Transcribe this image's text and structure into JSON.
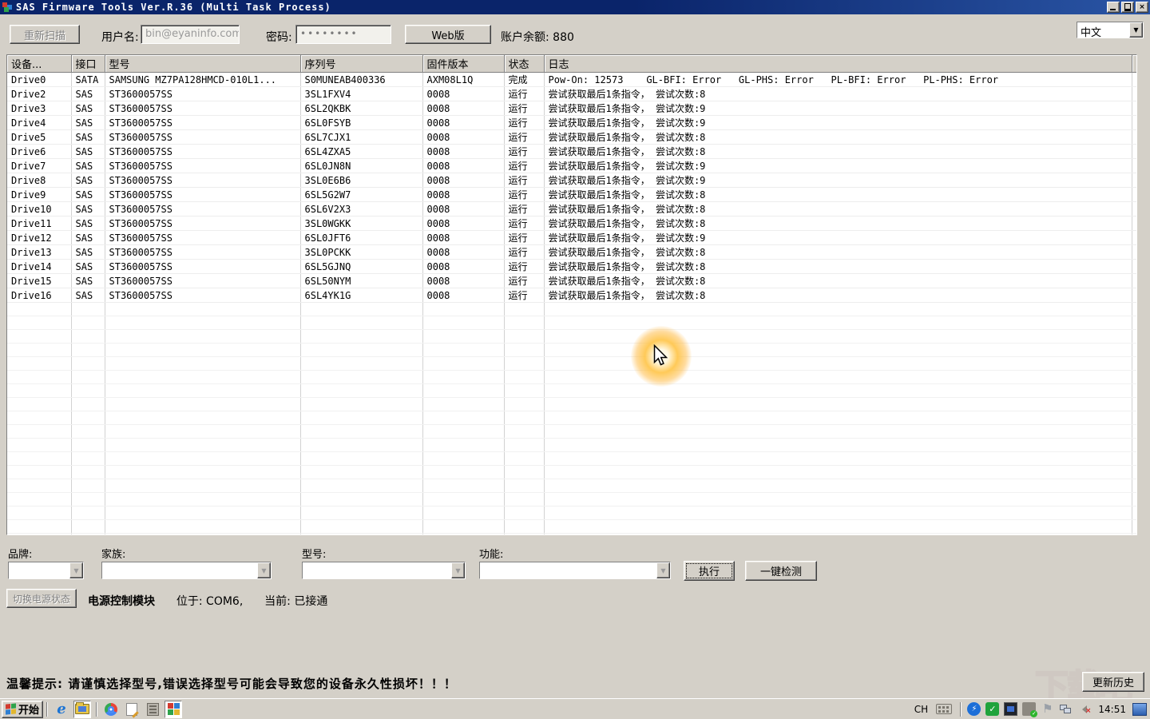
{
  "window": {
    "title": "SAS Firmware Tools Ver.R.36 (Multi Task Process)"
  },
  "toolbar": {
    "rescan": "重新扫描",
    "username_label": "用户名:",
    "username": "bin@eyaninfo.com",
    "password_label": "密码:",
    "password_masked": "••••••••",
    "web_version": "Web版",
    "balance": "账户余额: 880",
    "language": "中文",
    "dropdown_arrow": "▼"
  },
  "table": {
    "headers": [
      "设备...",
      "接口",
      "型号",
      "序列号",
      "固件版本",
      "状态",
      "日志"
    ],
    "rows": [
      [
        "Drive0",
        "SATA",
        "SAMSUNG MZ7PA128HMCD-010L1...",
        "S0MUNEAB400336",
        "AXM08L1Q",
        "完成",
        "Pow-On: 12573    GL-BFI: Error   GL-PHS: Error   PL-BFI: Error   PL-PHS: Error"
      ],
      [
        "Drive2",
        "SAS",
        "ST3600057SS",
        "3SL1FXV4",
        "0008",
        "运行",
        "尝试获取最后1条指令， 尝试次数:8"
      ],
      [
        "Drive3",
        "SAS",
        "ST3600057SS",
        "6SL2QKBK",
        "0008",
        "运行",
        "尝试获取最后1条指令， 尝试次数:9"
      ],
      [
        "Drive4",
        "SAS",
        "ST3600057SS",
        "6SL0FSYB",
        "0008",
        "运行",
        "尝试获取最后1条指令， 尝试次数:9"
      ],
      [
        "Drive5",
        "SAS",
        "ST3600057SS",
        "6SL7CJX1",
        "0008",
        "运行",
        "尝试获取最后1条指令， 尝试次数:8"
      ],
      [
        "Drive6",
        "SAS",
        "ST3600057SS",
        "6SL4ZXA5",
        "0008",
        "运行",
        "尝试获取最后1条指令， 尝试次数:8"
      ],
      [
        "Drive7",
        "SAS",
        "ST3600057SS",
        "6SL0JN8N",
        "0008",
        "运行",
        "尝试获取最后1条指令， 尝试次数:9"
      ],
      [
        "Drive8",
        "SAS",
        "ST3600057SS",
        "3SL0E6B6",
        "0008",
        "运行",
        "尝试获取最后1条指令， 尝试次数:9"
      ],
      [
        "Drive9",
        "SAS",
        "ST3600057SS",
        "6SL5G2W7",
        "0008",
        "运行",
        "尝试获取最后1条指令， 尝试次数:8"
      ],
      [
        "Drive10",
        "SAS",
        "ST3600057SS",
        "6SL6V2X3",
        "0008",
        "运行",
        "尝试获取最后1条指令， 尝试次数:8"
      ],
      [
        "Drive11",
        "SAS",
        "ST3600057SS",
        "3SL0WGKK",
        "0008",
        "运行",
        "尝试获取最后1条指令， 尝试次数:8"
      ],
      [
        "Drive12",
        "SAS",
        "ST3600057SS",
        "6SL0JFT6",
        "0008",
        "运行",
        "尝试获取最后1条指令， 尝试次数:9"
      ],
      [
        "Drive13",
        "SAS",
        "ST3600057SS",
        "3SL0PCKK",
        "0008",
        "运行",
        "尝试获取最后1条指令， 尝试次数:8"
      ],
      [
        "Drive14",
        "SAS",
        "ST3600057SS",
        "6SL5GJNQ",
        "0008",
        "运行",
        "尝试获取最后1条指令， 尝试次数:8"
      ],
      [
        "Drive15",
        "SAS",
        "ST3600057SS",
        "6SL50NYM",
        "0008",
        "运行",
        "尝试获取最后1条指令， 尝试次数:8"
      ],
      [
        "Drive16",
        "SAS",
        "ST3600057SS",
        "6SL4YK1G",
        "0008",
        "运行",
        "尝试获取最后1条指令， 尝试次数:8"
      ]
    ],
    "empty_rows": 19
  },
  "selectors": {
    "brand_label": "品牌:",
    "family_label": "家族:",
    "model_label": "型号:",
    "function_label": "功能:",
    "brand_value": "",
    "family_value": "",
    "model_value": "",
    "function_value": "",
    "execute": "执行",
    "one_click_detect": "一键检测"
  },
  "power": {
    "toggle": "切换电源状态",
    "module": "电源控制模块",
    "location": "位于: COM6,",
    "current": "当前: 已接通"
  },
  "footer": {
    "warning": "温馨提示: 请谨慎选择型号,错误选择型号可能会导致您的设备永久性损坏！！！",
    "update_history": "更新历史",
    "watermark": "下载吧"
  },
  "taskbar": {
    "start": "开始",
    "language_indicator": "CH",
    "time": "14:51"
  }
}
